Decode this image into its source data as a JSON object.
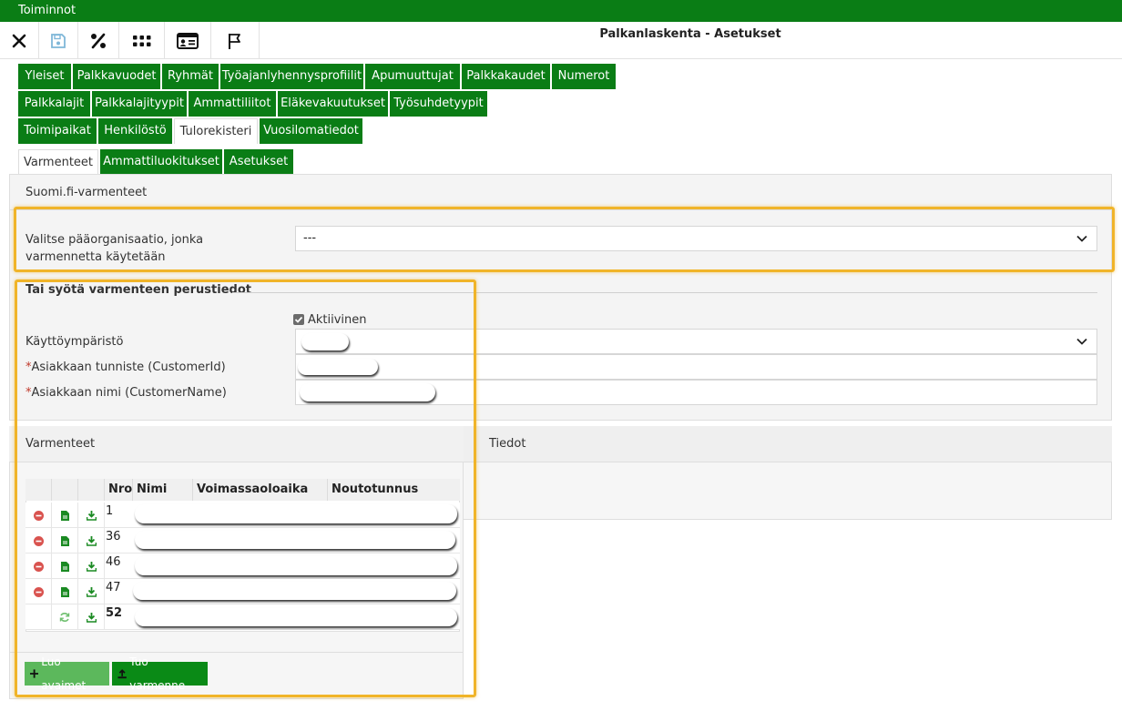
{
  "topbar": {
    "title": "Toiminnot"
  },
  "toolbar": {
    "icons": [
      "close-icon",
      "save-icon",
      "percent-icon",
      "grid-icon",
      "id-card-icon",
      "flag-icon"
    ]
  },
  "page_title": "Palkanlaskenta - Asetukset",
  "tabs_row1": [
    "Yleiset",
    "Palkkavuodet",
    "Ryhmät",
    "Työajanlyhennysprofiilit",
    "Apumuuttujat",
    "Palkkakaudet",
    "Numerot"
  ],
  "tabs_row2": [
    "Palkkalajit",
    "Palkkalajityypit",
    "Ammattiliitot",
    "Eläkevakuutukset",
    "Työsuhdetyypit"
  ],
  "tabs_row3": [
    "Toimipaikat",
    "Henkilöstö",
    "Tulorekisteri",
    "Vuosilomatiedot"
  ],
  "subtabs": [
    "Varmenteet",
    "Ammattiluokitukset",
    "Asetukset"
  ],
  "section": {
    "title": "Suomi.fi-varmenteet"
  },
  "org_select": {
    "label": "Valitse pääorganisaatio, jonka varmennetta käytetään",
    "value": "---"
  },
  "basic": {
    "legend": "Tai syötä varmenteen perustiedot",
    "active_label": "Aktiivinen",
    "environment_label": "Käyttöympäristö",
    "customer_id_label": "Asiakkaan tunniste (CustomerId)",
    "customer_name_label": "Asiakkaan nimi (CustomerName)",
    "required_mark": "*"
  },
  "certs": {
    "title": "Varmenteet",
    "details_title": "Tiedot",
    "columns": [
      "Nro",
      "Nimi",
      "Voimassaoloaika",
      "Noutotunnus"
    ],
    "rows": [
      {
        "nro": "1"
      },
      {
        "nro": "36"
      },
      {
        "nro": "46"
      },
      {
        "nro": "47"
      },
      {
        "nro": "52"
      }
    ],
    "btn_create_keys": "Luo avaimet",
    "btn_import_cert": "Tuo varmenne"
  }
}
